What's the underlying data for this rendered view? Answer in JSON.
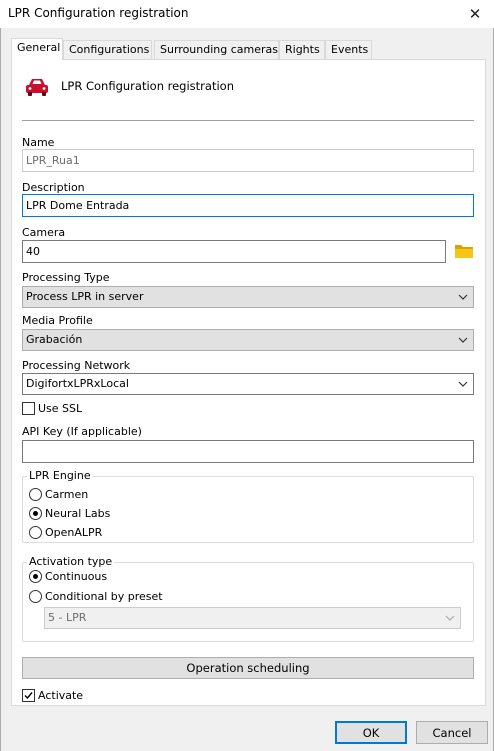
{
  "window": {
    "title": "LPR Configuration registration",
    "close_glyph": "✕"
  },
  "tabs": [
    {
      "label": "General"
    },
    {
      "label": "Configurations"
    },
    {
      "label": "Surrounding cameras"
    },
    {
      "label": "Rights"
    },
    {
      "label": "Events"
    }
  ],
  "header": {
    "title": "LPR Configuration registration",
    "icon": "car-icon"
  },
  "form": {
    "name_label": "Name",
    "name_value": "LPR_Rua1",
    "description_label": "Description",
    "description_value": "LPR Dome Entrada",
    "camera_label": "Camera",
    "camera_value": "40",
    "camera_browse_icon": "folder-icon",
    "processing_type_label": "Processing Type",
    "processing_type_value": "Process LPR in server",
    "media_profile_label": "Media Profile",
    "media_profile_value": "Grabación",
    "processing_network_label": "Processing Network",
    "processing_network_value": "DigifortxLPRxLocal",
    "use_ssl_label": "Use SSL",
    "use_ssl_checked": false,
    "api_key_label": "API Key (If applicable)",
    "api_key_value": ""
  },
  "lpr_engine": {
    "title": "LPR Engine",
    "options": [
      "Carmen",
      "Neural Labs",
      "OpenALPR"
    ],
    "selected": "Neural Labs"
  },
  "activation": {
    "title": "Activation type",
    "options": [
      "Continuous",
      "Conditional by preset"
    ],
    "selected": "Continuous",
    "preset_value": "5 - LPR"
  },
  "operation_scheduling_label": "Operation scheduling",
  "activate_label": "Activate",
  "activate_checked": true,
  "footer": {
    "ok_label": "OK",
    "cancel_label": "Cancel"
  },
  "colors": {
    "accent": "#0078d7",
    "car": "#c8102e",
    "folder": "#e8b400"
  }
}
